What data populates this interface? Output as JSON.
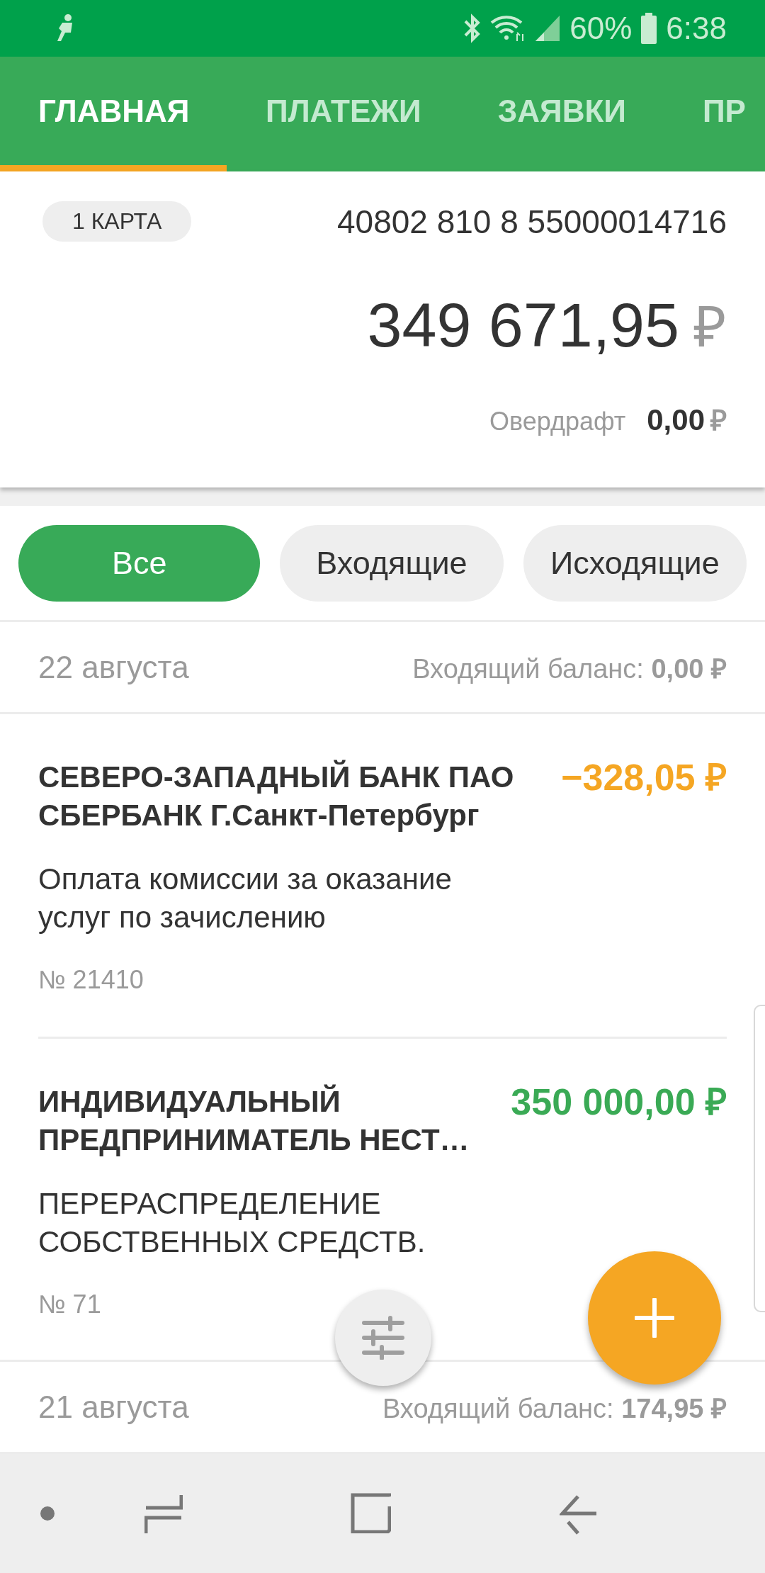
{
  "status_bar": {
    "battery_percent": "60%",
    "time": "6:38"
  },
  "tabs": [
    {
      "label": "ГЛАВНАЯ",
      "selected": true
    },
    {
      "label": "ПЛАТЕЖИ",
      "selected": false
    },
    {
      "label": "ЗАЯВКИ",
      "selected": false
    },
    {
      "label": "ПР",
      "selected": false
    }
  ],
  "account": {
    "cards_badge": "1 КАРТА",
    "number": "40802 810 8 55000014716",
    "balance": "349 671,95",
    "currency": "₽",
    "overdraft_label": "Овердрафт",
    "overdraft_value": "0,00",
    "overdraft_currency": "₽"
  },
  "filters": [
    {
      "label": "Все",
      "selected": true
    },
    {
      "label": "Входящие",
      "selected": false
    },
    {
      "label": "Исходящие",
      "selected": false
    }
  ],
  "days": [
    {
      "date": "22 августа",
      "balance_label": "Входящий баланс:",
      "balance_value": "0,00 ₽",
      "transactions": [
        {
          "counterparty": "СЕВЕРО-ЗАПАДНЫЙ БАНК ПАО СБЕРБАНК Г.Санкт-Петербург",
          "amount": "−328,05 ₽",
          "kind": "outgoing",
          "purpose": "Оплата комиссии за оказание услуг по зачислению",
          "number": "№ 21410"
        },
        {
          "counterparty": "ИНДИВИДУАЛЬНЫЙ ПРЕДПРИНИМАТЕЛЬ НЕСТ…",
          "amount": "350 000,00 ₽",
          "kind": "incoming",
          "purpose": "ПЕРЕРАСПРЕДЕЛЕНИЕ СОБСТВЕННЫХ СРЕДСТВ.",
          "number": "№ 71"
        }
      ]
    },
    {
      "date": "21 августа",
      "balance_label": "Входящий баланс:",
      "balance_value": "174,95 ₽"
    }
  ]
}
